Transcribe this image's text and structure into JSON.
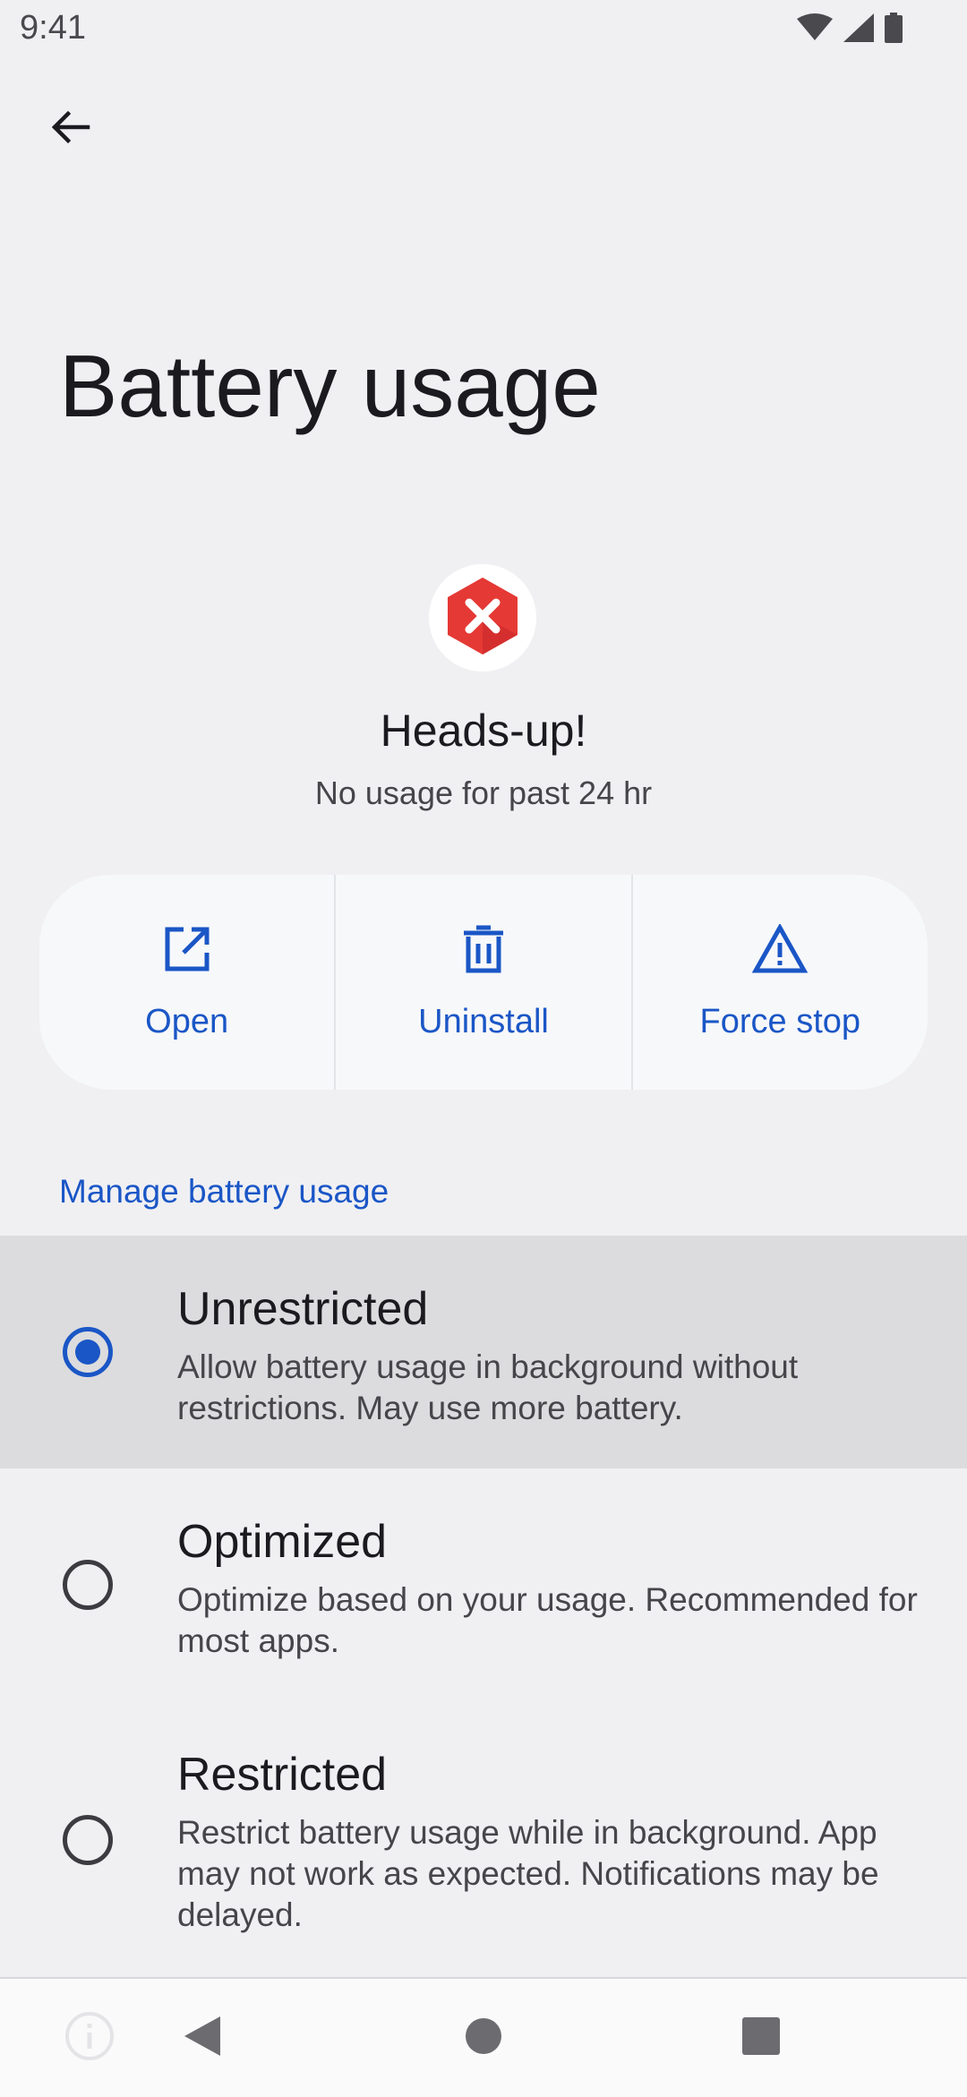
{
  "status_bar": {
    "time": "9:41",
    "icons": [
      "wifi-icon",
      "cellular-signal-icon",
      "battery-icon"
    ]
  },
  "header": {
    "back_icon": "arrow-back-icon",
    "title": "Battery usage"
  },
  "app": {
    "icon": "app-error-icon",
    "icon_color": "#e53935",
    "name": "Heads-up!",
    "summary": "No usage for past 24 hr"
  },
  "actions": [
    {
      "label": "Open",
      "icon": "open-external-icon"
    },
    {
      "label": "Uninstall",
      "icon": "trash-icon"
    },
    {
      "label": "Force stop",
      "icon": "warning-icon"
    }
  ],
  "manage": {
    "header": "Manage battery usage",
    "options": [
      {
        "title": "Unrestricted",
        "description": "Allow battery usage in background without restrictions. May use more battery.",
        "selected": true
      },
      {
        "title": "Optimized",
        "description": "Optimize based on your usage. Recommended for most apps.",
        "selected": false
      },
      {
        "title": "Restricted",
        "description": "Restrict battery usage while in background. App may not work as expected. Notifications may be delayed.",
        "selected": false
      }
    ]
  },
  "nav_bar": {
    "icons": [
      "info-icon",
      "nav-back-icon",
      "nav-home-icon",
      "nav-recents-icon"
    ]
  },
  "colors": {
    "accent": "#1a56c6",
    "background": "#f0f0f3",
    "selected_row": "#dcdcde"
  }
}
